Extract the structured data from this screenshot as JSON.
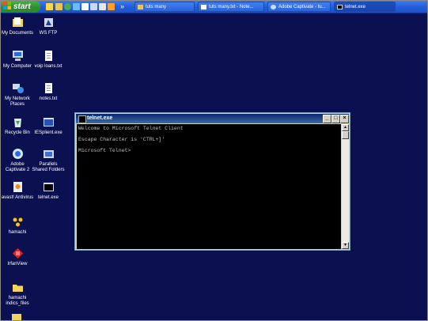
{
  "taskbar": {
    "start_label": "start",
    "quick_launch_icons": [
      "ie-icon",
      "folder-icon",
      "media-icon",
      "chat-icon",
      "app-icon",
      "app-icon",
      "app-icon",
      "app-icon"
    ],
    "more_label": "»",
    "buttons": [
      {
        "label": "tuts many",
        "icon": "folder-icon"
      },
      {
        "label": "tuts many.txt - Note...",
        "icon": "notepad-icon"
      },
      {
        "label": "Adobe Captivate - tu...",
        "icon": "captivate-icon"
      },
      {
        "label": "telnet.exe",
        "icon": "console-icon"
      }
    ]
  },
  "desktop": {
    "icons": [
      {
        "label": "My Documents",
        "icon": "my-documents-icon"
      },
      {
        "label": "WS FTP",
        "icon": "ws-ftp-icon"
      },
      {
        "label": "My Computer",
        "icon": "my-computer-icon"
      },
      {
        "label": "voip loans.txt",
        "icon": "text-file-icon"
      },
      {
        "label": "My Network Places",
        "icon": "network-places-icon"
      },
      {
        "label": "notes.txt",
        "icon": "text-file-icon"
      },
      {
        "label": "Recycle Bin",
        "icon": "recycle-bin-icon"
      },
      {
        "label": "IESplient.exe",
        "icon": "exe-icon"
      },
      {
        "label": "Adobe Captivate 2",
        "icon": "captivate-icon"
      },
      {
        "label": "Parallels Shared Folders",
        "icon": "parallels-icon"
      },
      {
        "label": "avast! Antivirus",
        "icon": "avast-icon"
      },
      {
        "label": "telnet.exe",
        "icon": "exe-icon"
      },
      {
        "label": "hamachi",
        "icon": "hamachi-icon"
      },
      {
        "label": "IrfanView",
        "icon": "irfanview-icon"
      },
      {
        "label": "hamachi indics_files",
        "icon": "folder-icon"
      }
    ]
  },
  "window": {
    "title": "telnet.exe",
    "minimize": "_",
    "maximize": "□",
    "close": "×",
    "console_lines": [
      "Welcome to Microsoft Telnet Client",
      "",
      "Escape Character is 'CTRL+]'",
      "",
      "Microsoft Telnet>"
    ],
    "scroll_up": "▲",
    "scroll_down": "▼"
  },
  "colors": {
    "desktop": "#0b1050",
    "taskbar": "#245edb",
    "start": "#2f8f2f",
    "titlebar": "#0a246a",
    "console_bg": "#000000",
    "console_text": "#c0c0c0"
  }
}
